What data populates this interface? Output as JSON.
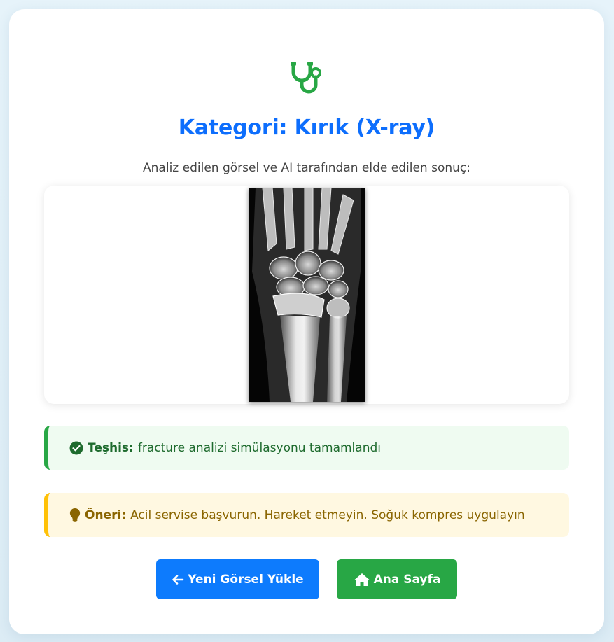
{
  "header": {
    "logo_icon": "stethoscope-icon",
    "title": "Kategori: Kırık (X-ray)",
    "subtitle": "Analiz edilen görsel ve AI tarafından elde edilen sonuç:"
  },
  "image": {
    "alt": "Bilek X-ray görüntüsü"
  },
  "diagnosis": {
    "icon": "check-circle-icon",
    "label": "Teşhis:",
    "text": "fracture analizi simülasyonu tamamlandı",
    "color": "#28a745"
  },
  "recommendation": {
    "icon": "lightbulb-icon",
    "label": "Öneri:",
    "text": "Acil servise başvurun. Hareket etmeyin. Soğuk kompres uygulayın",
    "color": "#ffc107"
  },
  "buttons": {
    "upload_icon": "arrow-left-icon",
    "upload_label": "Yeni Görsel Yükle",
    "upload_color": "#0d7bfd",
    "home_icon": "home-icon",
    "home_label": "Ana Sayfa",
    "home_color": "#28a745"
  },
  "colors": {
    "accent": "#0d6efd",
    "logo": "#28a745"
  }
}
